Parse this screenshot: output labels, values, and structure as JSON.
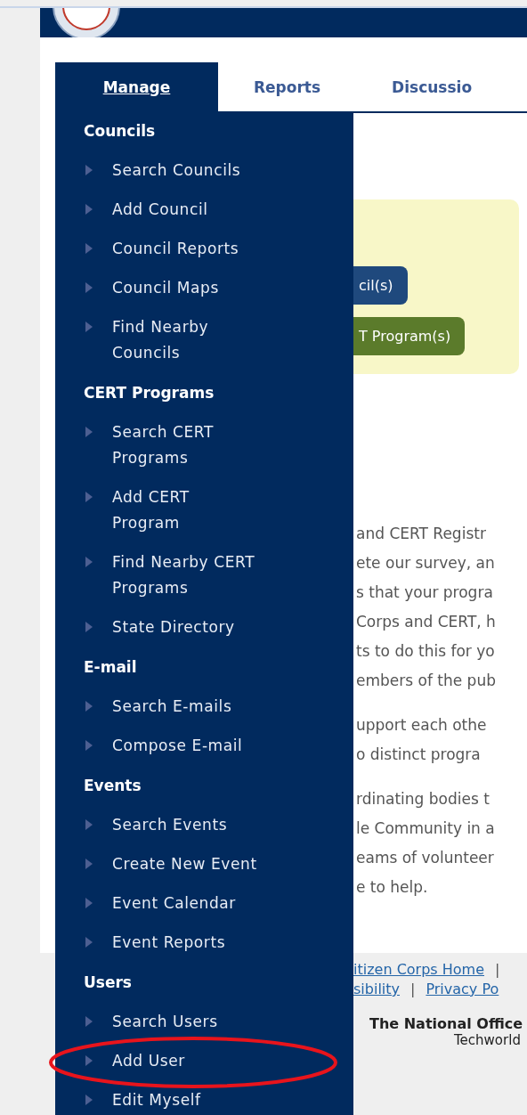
{
  "tabs": [
    {
      "label": "Manage",
      "selected": true
    },
    {
      "label": "Reports",
      "selected": false
    },
    {
      "label": "Discussio",
      "selected": false
    }
  ],
  "menu": {
    "groups": [
      {
        "heading": "Councils",
        "items": [
          {
            "label": "Search Councils",
            "circled": false
          },
          {
            "label": "Add Council",
            "circled": false
          },
          {
            "label": "Council Reports",
            "circled": false
          },
          {
            "label": "Council Maps",
            "circled": false
          },
          {
            "label": "Find Nearby Councils",
            "circled": false
          }
        ]
      },
      {
        "heading": "CERT Programs",
        "items": [
          {
            "label": "Search CERT Programs",
            "circled": false
          },
          {
            "label": "Add CERT Program",
            "circled": false
          },
          {
            "label": "Find Nearby CERT Programs",
            "circled": false
          },
          {
            "label": "State Directory",
            "circled": false
          }
        ]
      },
      {
        "heading": "E-mail",
        "items": [
          {
            "label": "Search E-mails",
            "circled": false
          },
          {
            "label": "Compose E-mail",
            "circled": false
          }
        ]
      },
      {
        "heading": "Events",
        "items": [
          {
            "label": "Search Events",
            "circled": false
          },
          {
            "label": "Create New Event",
            "circled": false
          },
          {
            "label": "Event Calendar",
            "circled": false
          },
          {
            "label": "Event Reports",
            "circled": false
          }
        ]
      },
      {
        "heading": "Users",
        "items": [
          {
            "label": "Search Users",
            "circled": false
          },
          {
            "label": "Add User",
            "circled": true
          },
          {
            "label": "Edit Myself",
            "circled": false
          }
        ]
      }
    ]
  },
  "panel": {
    "buttons": [
      {
        "label": "cil(s)",
        "color": "#1f497d"
      },
      {
        "label": "T Program(s)",
        "color": "#5b7b2b"
      }
    ]
  },
  "paragraphs": [
    [
      "and CERT Registr",
      "ete our survey, an",
      "s that your progra",
      "Corps and CERT, h",
      "ts to do this for yo",
      "embers of the pub"
    ],
    [
      "upport each othe",
      "o distinct progra"
    ],
    [
      "rdinating bodies t",
      "le Community in a",
      "eams of volunteer",
      "e to help."
    ]
  ],
  "footer": {
    "lines": [
      [
        {
          "kind": "link",
          "text": "itizen Corps Home"
        },
        {
          "kind": "separator",
          "text": "|"
        }
      ],
      [
        {
          "kind": "link",
          "text": "sibility"
        },
        {
          "kind": "separator",
          "text": "|"
        },
        {
          "kind": "link",
          "text": "Privacy Po"
        }
      ]
    ],
    "office": "The National Office",
    "location": "Techworld"
  }
}
